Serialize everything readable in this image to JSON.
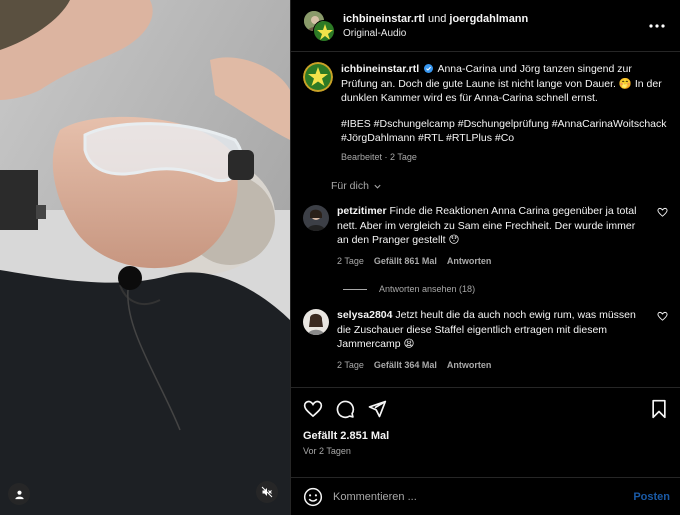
{
  "header": {
    "account1": "ichbineinstar.rtl",
    "connector": "und",
    "account2": "joergdahlmann",
    "audio": "Original-Audio"
  },
  "caption": {
    "username": "ichbineinstar.rtl",
    "text": "Anna-Carina und Jörg tanzen singend zur Prüfung an. Doch die gute Laune ist nicht lange von Dauer. 🤭 In der dunklen Kammer wird es für Anna-Carina schnell ernst.",
    "hashtags": "#IBES #Dschungelcamp #Dschungelprüfung #AnnaCarinaWoitschack #JörgDahlmann #RTL #RTLPlus #Co",
    "meta": "Bearbeitet · 2 Tage"
  },
  "sort_label": "Für dich",
  "comments": [
    {
      "username": "petzitimer",
      "text": "Finde die Reaktionen Anna Carina gegenüber ja total nett. Aber im vergleich zu Sam eine Frechheit. Der wurde immer an den Pranger gestellt 😯",
      "time": "2 Tage",
      "likes": "Gefällt 861 Mal",
      "reply": "Antworten"
    },
    {
      "username": "selysa2804",
      "text": "Jetzt heult die da auch noch ewig rum, was müssen die Zuschauer diese Staffel eigentlich ertragen mit diesem Jammercamp 😫",
      "time": "2 Tage",
      "likes": "Gefällt 364 Mal",
      "reply": "Antworten"
    }
  ],
  "view_replies": "Antworten ansehen (18)",
  "actions": {
    "likes": "Gefällt 2.851 Mal",
    "posted": "Vor 2 Tagen"
  },
  "composer": {
    "placeholder": "Kommentieren ...",
    "post_label": "Posten"
  },
  "colors": {
    "background": "#000000",
    "divider": "#262626",
    "secondary_text": "#a8a8a8",
    "post_button": "#1a5aa6",
    "verified": "#3897f0"
  },
  "icons": [
    "more-horizontal-icon",
    "verified-badge-icon",
    "chevron-down-icon",
    "heart-icon",
    "comment-icon",
    "share-icon",
    "bookmark-icon",
    "emoji-icon",
    "user-tag-icon",
    "muted-speaker-icon"
  ]
}
